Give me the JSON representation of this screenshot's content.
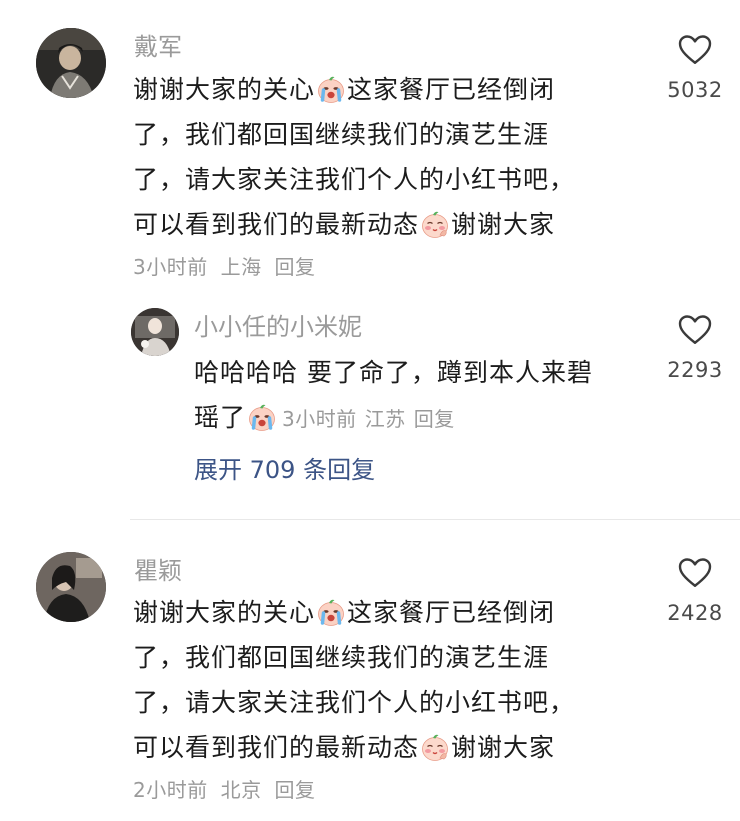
{
  "comments": [
    {
      "username": "戴军",
      "avatar": "avatar-photo",
      "lines": [
        {
          "a": "谢谢大家的关心",
          "b": "这家餐厅已经倒闭"
        },
        {
          "a": "了，我们都回国继续我们的演艺生涯"
        },
        {
          "a": "了，请大家关注我们个人的小红书吧，"
        },
        {
          "a": "可以看到我们的最新动态",
          "b": "谢谢大家"
        }
      ],
      "emoji1": "crying-face-emoji",
      "emoji2": "blushing-face-emoji",
      "time": "3小时前",
      "location": "上海",
      "reply": "回复",
      "likes": "5032"
    },
    {
      "username": "小小任的小米妮",
      "avatar": "avatar-photo",
      "line1": "哈哈哈哈 要了命了，蹲到本人来碧",
      "line2": "瑶了",
      "emoji": "crying-face-emoji",
      "time": "3小时前",
      "location": "江苏",
      "reply": "回复",
      "likes": "2293"
    },
    {
      "username": "瞿颖",
      "avatar": "avatar-photo",
      "lines": [
        {
          "a": "谢谢大家的关心",
          "b": "这家餐厅已经倒闭"
        },
        {
          "a": "了，我们都回国继续我们的演艺生涯"
        },
        {
          "a": "了，请大家关注我们个人的小红书吧，"
        },
        {
          "a": "可以看到我们的最新动态",
          "b": "谢谢大家"
        }
      ],
      "time": "2小时前",
      "location": "北京",
      "reply": "回复",
      "likes": "2428"
    }
  ],
  "expand_replies": "展开 709 条回复",
  "icons": {
    "like": "heart-outline-icon"
  },
  "colors": {
    "text": "#1c1c1c",
    "meta": "#9a9a9a",
    "link": "#3c5486",
    "background": "#ffffff"
  }
}
